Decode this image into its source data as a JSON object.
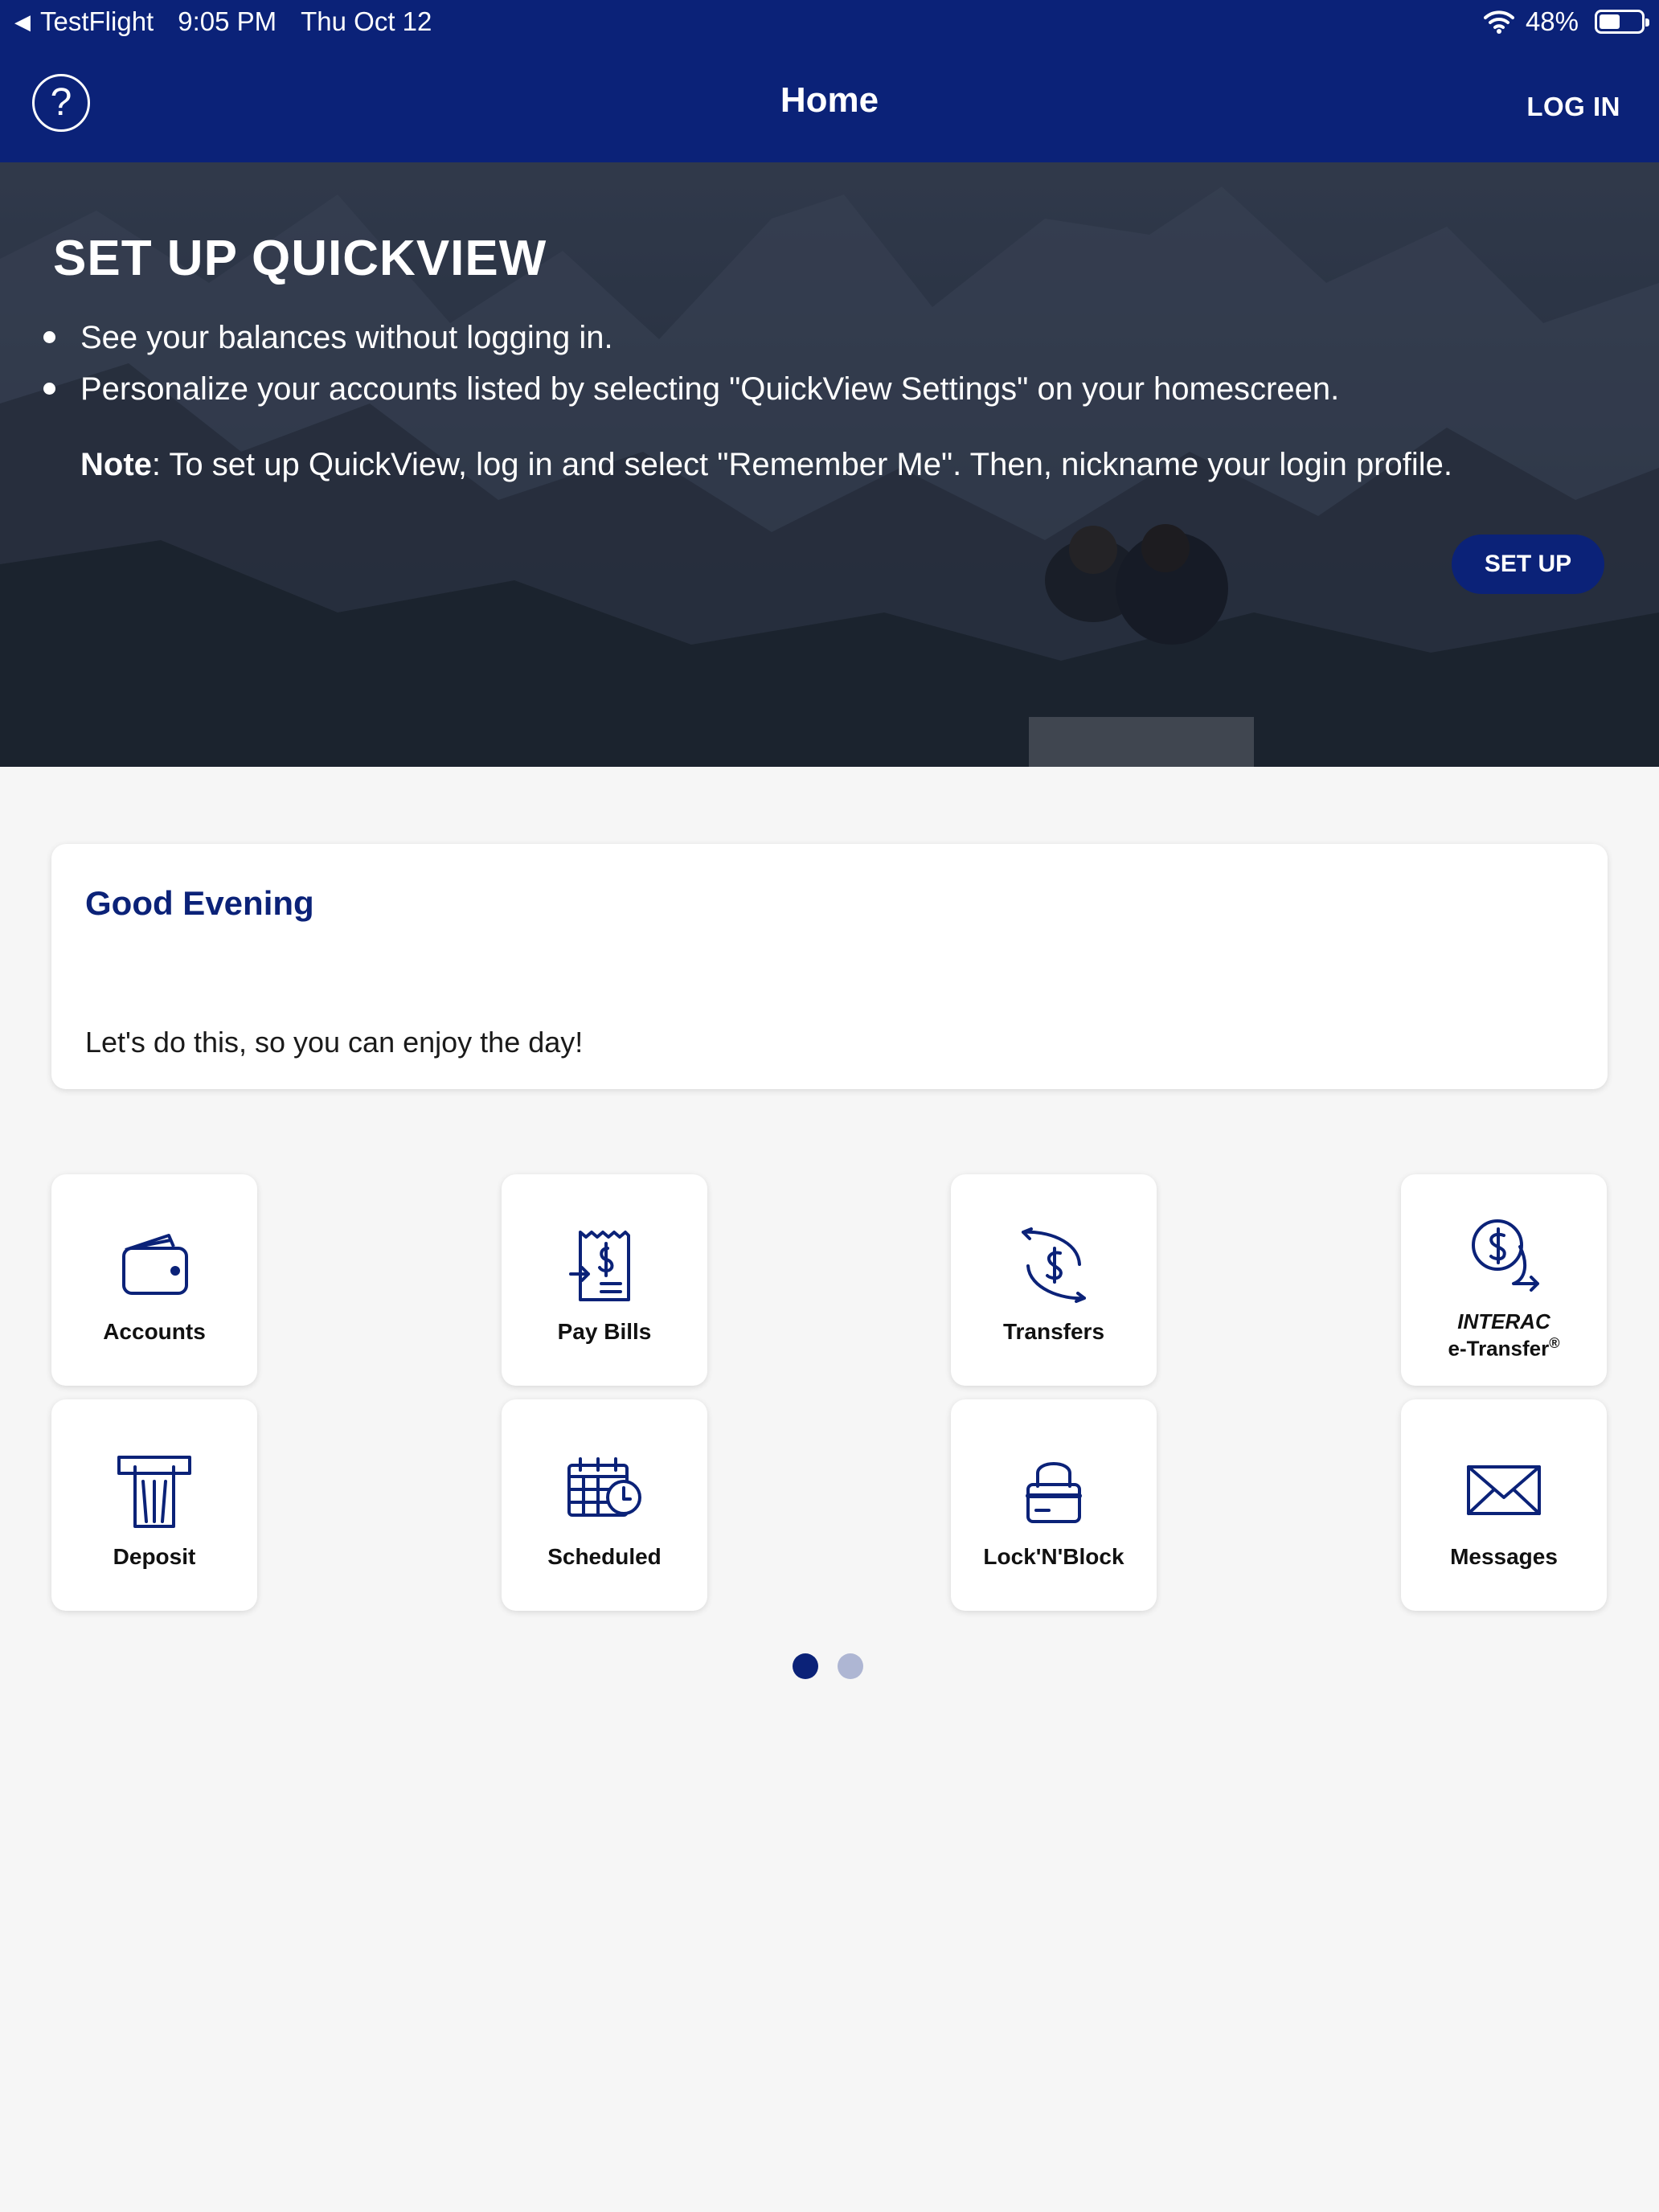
{
  "status_bar": {
    "back_app": "TestFlight",
    "time": "9:05 PM",
    "date": "Thu Oct 12",
    "battery": "48%",
    "battery_level": 0.48
  },
  "header": {
    "help_glyph": "?",
    "title": "Home",
    "login_label": "LOG IN"
  },
  "banner": {
    "title": "SET UP QUICKVIEW",
    "bullets": [
      "See your balances without logging in.",
      "Personalize your accounts listed by selecting \"QuickView Settings\" on your homescreen."
    ],
    "note_label": "Note",
    "note_text": ": To set up QuickView, log in and select \"Remember Me\". Then, nickname your login profile.",
    "setup_label": "SET UP"
  },
  "greeting": {
    "title": "Good Evening",
    "subtitle": "Let's do this, so you can enjoy the day!"
  },
  "tiles": [
    {
      "label": "Accounts",
      "icon": "wallet-icon"
    },
    {
      "label": "Pay Bills",
      "icon": "bill-icon"
    },
    {
      "label": "Transfers",
      "icon": "transfer-icon"
    },
    {
      "label_line1": "INTERAC",
      "label_line2": "e-Transfer",
      "label_sup": "®",
      "icon": "etransfer-icon"
    },
    {
      "label": "Deposit",
      "icon": "deposit-icon"
    },
    {
      "label": "Scheduled",
      "icon": "calendar-clock-icon"
    },
    {
      "label": "Lock'N'Block",
      "icon": "card-lock-icon"
    },
    {
      "label": "Messages",
      "icon": "envelope-icon"
    }
  ],
  "pager": {
    "pages": 2,
    "current": 1
  },
  "colors": {
    "brand_navy": "#0b2278",
    "background": "#f6f6f6",
    "pager_inactive": "#aeb6d3"
  }
}
